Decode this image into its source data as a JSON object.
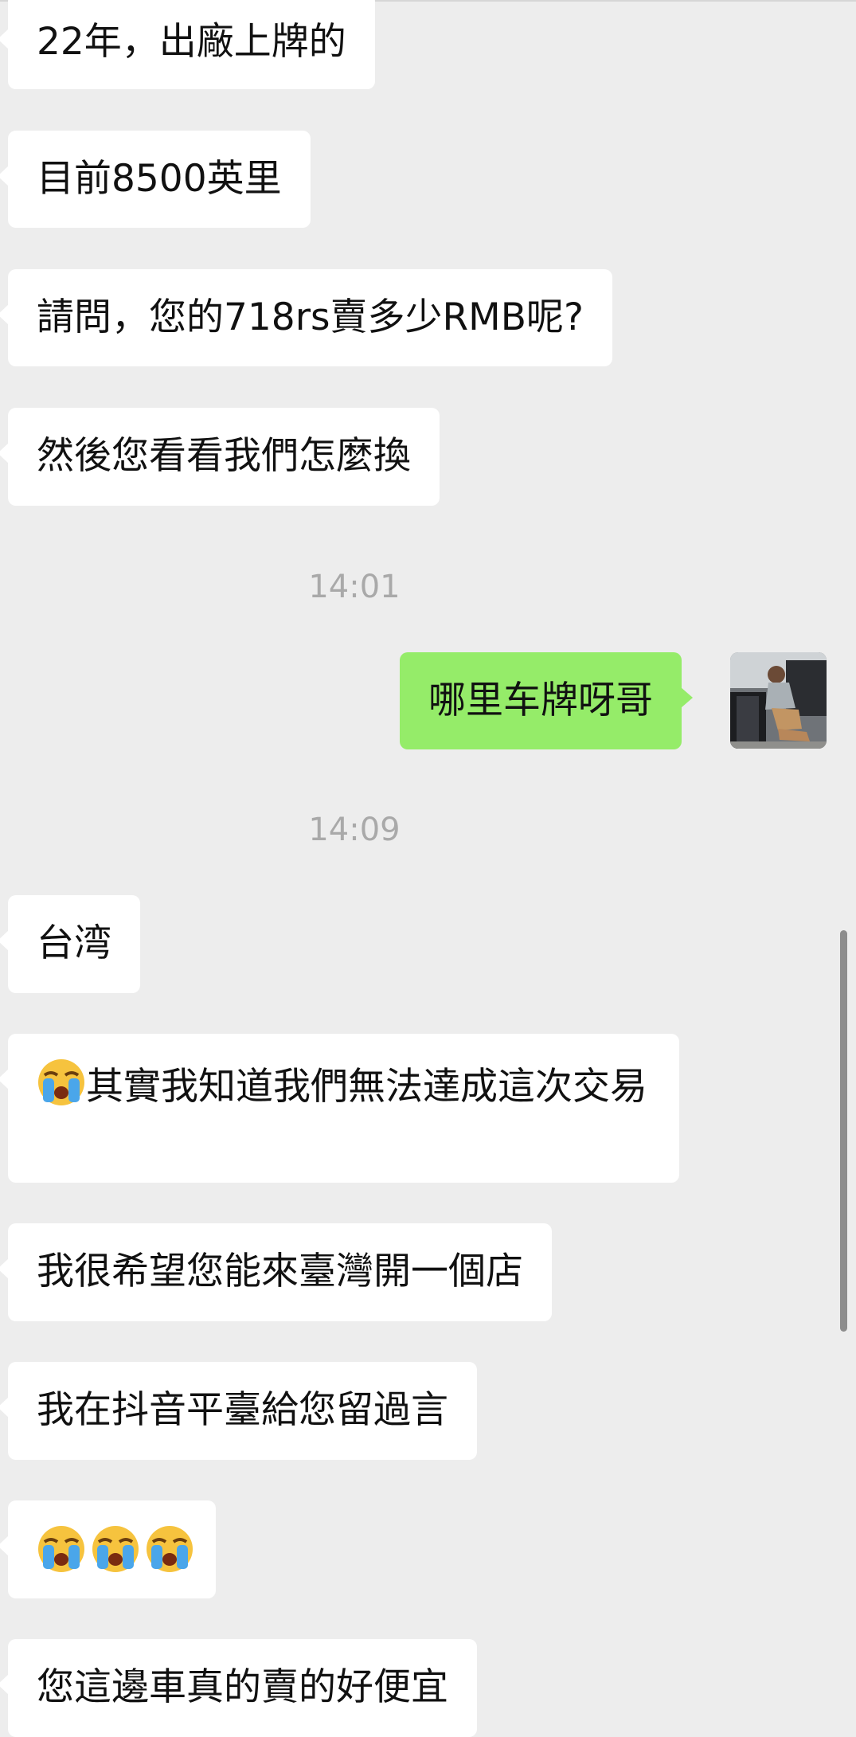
{
  "messages": [
    {
      "id": "m1",
      "side": "received",
      "text": "22年，出廠上牌的"
    },
    {
      "id": "m2",
      "side": "received",
      "text": "目前8500英里"
    },
    {
      "id": "m3",
      "side": "received",
      "text": "請問，您的718rs賣多少RMB呢?"
    },
    {
      "id": "m4",
      "side": "received",
      "text": "然後您看看我們怎麼換"
    },
    {
      "id": "t1",
      "type": "timestamp",
      "text": "14:01"
    },
    {
      "id": "m5",
      "side": "sent",
      "text": "哪里车牌呀哥"
    },
    {
      "id": "t2",
      "type": "timestamp",
      "text": "14:09"
    },
    {
      "id": "m6",
      "side": "received",
      "text": "台湾"
    },
    {
      "id": "m7",
      "side": "received",
      "emoji": "loudly-crying-face",
      "text": "其實我知道我們無法達成這次交易"
    },
    {
      "id": "m8",
      "side": "received",
      "text": "我很希望您能來臺灣開一個店"
    },
    {
      "id": "m9",
      "side": "received",
      "text": "我在抖音平臺給您留過言"
    },
    {
      "id": "m10",
      "side": "received",
      "emoji_count": 3,
      "emoji": "loudly-crying-face"
    },
    {
      "id": "m11",
      "side": "received",
      "text": "您這邊車真的賣的好便宜"
    }
  ],
  "colors": {
    "background": "#ededed",
    "received_bubble": "#ffffff",
    "sent_bubble": "#95ec69",
    "timestamp": "#a9a9a9"
  }
}
